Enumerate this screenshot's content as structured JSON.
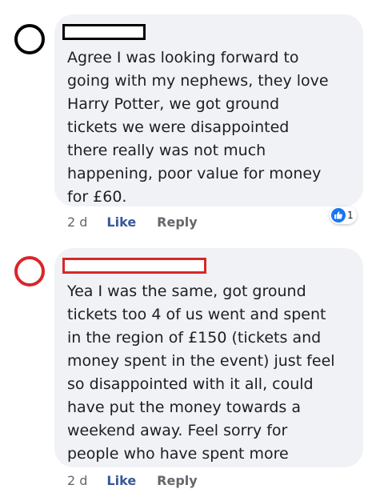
{
  "comments": [
    {
      "text": "Agree I was looking forward to\ngoing with my nephews, they love\nHarry Potter, we got ground\ntickets we were disappointed\nthere really was not much\nhappening, poor value for money\nfor £60.",
      "timestamp": "2 d",
      "like_label": "Like",
      "reply_label": "Reply",
      "reaction": {
        "icon": "thumbs-up-icon",
        "count": "1",
        "color": "#1877f2"
      },
      "highlight_color": "#000000"
    },
    {
      "text": "Yea I was the same, got ground\ntickets too 4 of us went and spent\nin the region of £150 (tickets and\nmoney spent in the event) just feel\nso disappointed with it all, could\nhave put the money towards a\nweekend away. Feel sorry for\npeople who have spent more",
      "timestamp": "2 d",
      "like_label": "Like",
      "reply_label": "Reply",
      "highlight_color": "#d8262a"
    }
  ]
}
